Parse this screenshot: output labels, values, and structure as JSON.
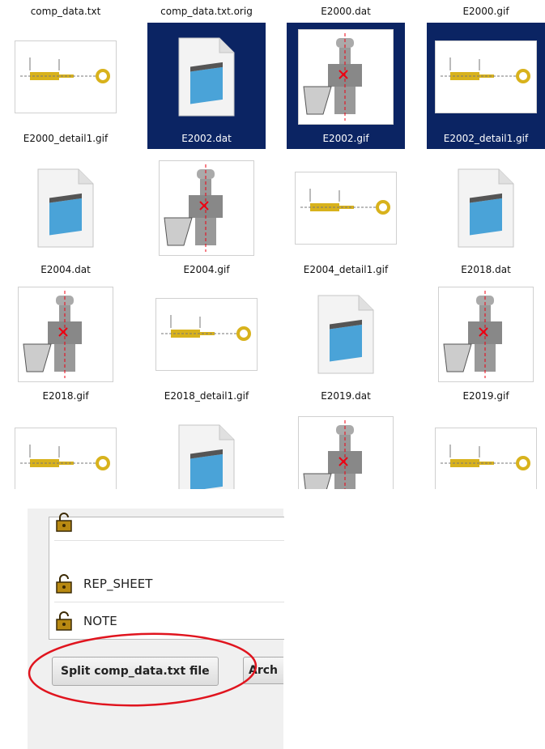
{
  "explorer": {
    "top_labels": [
      "comp_data.txt",
      "comp_data.txt.orig",
      "E2000.dat",
      "E2000.gif"
    ],
    "files": [
      {
        "name": "E2000_detail1.gif",
        "kind": "gif-detail",
        "selected": false
      },
      {
        "name": "E2002.dat",
        "kind": "dat",
        "selected": true
      },
      {
        "name": "E2002.gif",
        "kind": "gif-drawing",
        "selected": true
      },
      {
        "name": "E2002_detail1.gif",
        "kind": "gif-detail",
        "selected": true
      },
      {
        "name": "E2004.dat",
        "kind": "dat",
        "selected": false
      },
      {
        "name": "E2004.gif",
        "kind": "gif-drawing",
        "selected": false
      },
      {
        "name": "E2004_detail1.gif",
        "kind": "gif-detail",
        "selected": false
      },
      {
        "name": "E2018.dat",
        "kind": "dat",
        "selected": false
      },
      {
        "name": "E2018.gif",
        "kind": "gif-drawing",
        "selected": false
      },
      {
        "name": "E2018_detail1.gif",
        "kind": "gif-detail",
        "selected": false
      },
      {
        "name": "E2019.dat",
        "kind": "dat",
        "selected": false
      },
      {
        "name": "E2019.gif",
        "kind": "gif-drawing",
        "selected": false
      }
    ],
    "selection_color": "#0b2463"
  },
  "panel": {
    "items": [
      {
        "label": "",
        "icon": "lock-icon"
      },
      {
        "label": "REP_SHEET",
        "icon": "lock-icon"
      },
      {
        "label": "NOTE",
        "icon": "lock-icon"
      }
    ],
    "split_button": "Split comp_data.txt file",
    "archive_button": "Arch",
    "highlight_color": "#e0141e"
  }
}
